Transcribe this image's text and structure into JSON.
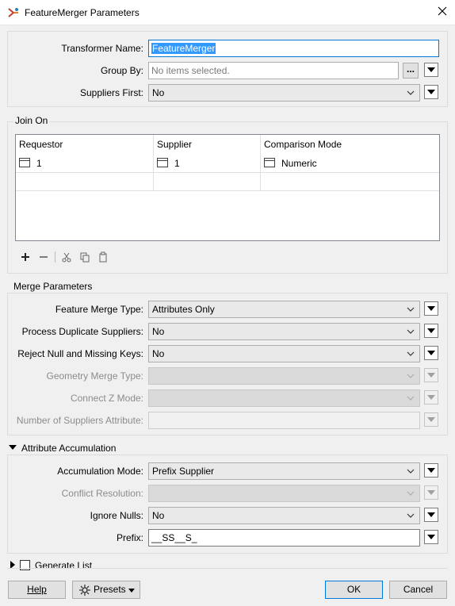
{
  "window": {
    "title": "FeatureMerger Parameters"
  },
  "top": {
    "transformer_name": {
      "label": "Transformer Name:",
      "value": "FeatureMerger"
    },
    "group_by": {
      "label": "Group By:",
      "placeholder": "No items selected.",
      "button": "..."
    },
    "suppliers_first": {
      "label": "Suppliers First:",
      "value": "No"
    }
  },
  "join_on": {
    "title": "Join On",
    "columns": [
      "Requestor",
      "Supplier",
      "Comparison Mode"
    ],
    "rows": [
      {
        "requestor": "1",
        "supplier": "1",
        "mode": "Numeric"
      }
    ]
  },
  "merge": {
    "title": "Merge Parameters",
    "feature_merge_type": {
      "label": "Feature Merge Type:",
      "value": "Attributes Only"
    },
    "process_duplicate_suppliers": {
      "label": "Process Duplicate Suppliers:",
      "value": "No"
    },
    "reject_null": {
      "label": "Reject Null and Missing Keys:",
      "value": "No"
    },
    "geometry_merge_type": {
      "label": "Geometry Merge Type:",
      "value": ""
    },
    "connect_z_mode": {
      "label": "Connect Z Mode:",
      "value": ""
    },
    "number_of_suppliers_attribute": {
      "label": "Number of Suppliers Attribute:",
      "value": ""
    }
  },
  "accumulation": {
    "title": "Attribute Accumulation",
    "mode": {
      "label": "Accumulation Mode:",
      "value": "Prefix Supplier"
    },
    "conflict_resolution": {
      "label": "Conflict Resolution:",
      "value": ""
    },
    "ignore_nulls": {
      "label": "Ignore Nulls:",
      "value": "No"
    },
    "prefix": {
      "label": "Prefix:",
      "value": "__SS__S_"
    }
  },
  "generate_list": {
    "label": "Generate List",
    "checked": false
  },
  "buttons": {
    "help": "Help",
    "presets": "Presets",
    "ok": "OK",
    "cancel": "Cancel"
  },
  "colors": {
    "accent": "#0078d7",
    "selection": "#3399ff"
  }
}
